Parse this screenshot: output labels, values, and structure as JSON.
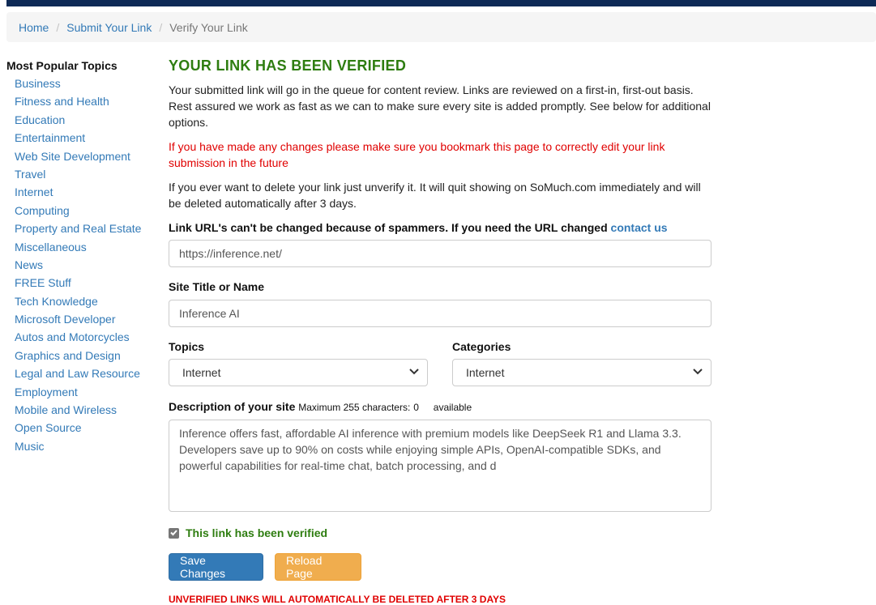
{
  "colors": {
    "top_bar": "#0e2a56",
    "link": "#337ab7",
    "heading": "#2e7d10",
    "alert": "#e00000",
    "primary_button": "#337ab7",
    "warning_button": "#f0ad4e"
  },
  "breadcrumb": {
    "items": [
      "Home",
      "Submit Your Link"
    ],
    "current": "Verify Your Link",
    "separator": "/"
  },
  "sidebar": {
    "title": "Most Popular Topics",
    "items": [
      "Business",
      "Fitness and Health",
      "Education",
      "Entertainment",
      "Web Site Development",
      "Travel",
      "Internet",
      "Computing",
      "Property and Real Estate",
      "Miscellaneous",
      "News",
      "FREE Stuff",
      "Tech Knowledge",
      "Microsoft Developer",
      "Autos and Motorcycles",
      "Graphics and Design",
      "Legal and Law Resource",
      "Employment",
      "Mobile and Wireless",
      "Open Source",
      "Music"
    ]
  },
  "main": {
    "heading": "YOUR LINK HAS BEEN VERIFIED",
    "intro": "Your submitted link will go in the queue for content review. Links are reviewed on a first-in, first-out basis. Rest assured we work as fast as we can to make sure every site is added promptly. See below for additional options.",
    "bookmark_notice": "If you have made any changes please make sure you bookmark this page to correctly edit your link submission in the future",
    "delete_info": "If you ever want to delete your link just unverify it. It will quit showing on SoMuch.com immediately and will be deleted automatically after 3 days.",
    "url_label": "Link URL's can't be changed because of spammers. If you need the URL changed",
    "contact_link": "contact us",
    "url_value": "https://inference.net/",
    "title_label": "Site Title or Name",
    "title_value": "Inference AI",
    "topics_label": "Topics",
    "topics_value": "Internet",
    "categories_label": "Categories",
    "categories_value": "Internet",
    "description_label": "Description of your site",
    "max_chars_text": "Maximum 255 characters:",
    "chars_count": "0",
    "available_text": "available",
    "description_value": "Inference offers fast, affordable AI inference with premium models like DeepSeek R1 and Llama 3.3. Developers save up to 90% on costs while enjoying simple APIs, OpenAI-compatible SDKs, and powerful capabilities for real-time chat, batch processing, and d",
    "verified_checked": true,
    "verified_label": "This link has been verified",
    "save_button": "Save Changes",
    "reload_button": "Reload Page",
    "warning": "UNVERIFIED LINKS WILL AUTOMATICALLY BE DELETED AFTER 3 DAYS"
  }
}
